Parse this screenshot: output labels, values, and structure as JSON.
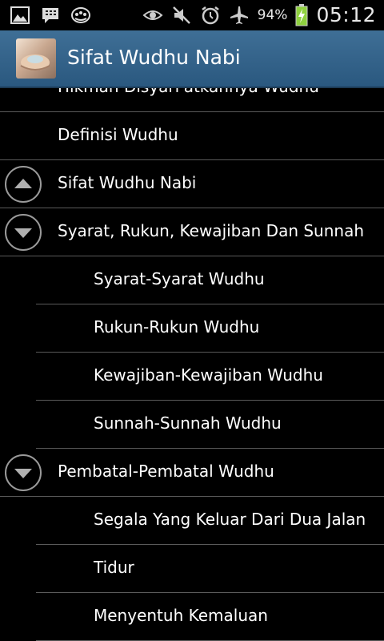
{
  "status_bar": {
    "left_icons": [
      "gallery-icon",
      "bbm-icon",
      "app-update-icon"
    ],
    "right_icons": [
      "eye-icon",
      "mute-icon",
      "alarm-icon",
      "airplane-icon",
      "battery-charging-icon"
    ],
    "battery": "94%",
    "time": "05:12"
  },
  "action_bar": {
    "title": "Sifat Wudhu Nabi",
    "bg_color": "#33658c"
  },
  "list": {
    "partial_top": "Hikmah Disyari'atkannya Wudhu",
    "rows": [
      {
        "type": "group",
        "label": "Definisi Wudhu",
        "indicator": null
      },
      {
        "type": "group",
        "label": "Sifat Wudhu Nabi",
        "indicator": "collapsed"
      },
      {
        "type": "group",
        "label": "Syarat, Rukun, Kewajiban Dan Sunnah",
        "indicator": "expanded"
      },
      {
        "type": "child",
        "label": "Syarat-Syarat Wudhu"
      },
      {
        "type": "child",
        "label": "Rukun-Rukun Wudhu"
      },
      {
        "type": "child",
        "label": "Kewajiban-Kewajiban Wudhu"
      },
      {
        "type": "child",
        "label": "Sunnah-Sunnah Wudhu"
      },
      {
        "type": "group",
        "label": "Pembatal-Pembatal Wudhu",
        "indicator": "expanded"
      },
      {
        "type": "child",
        "label": "Segala Yang Keluar Dari Dua Jalan"
      },
      {
        "type": "child",
        "label": "Tidur"
      },
      {
        "type": "child",
        "label": "Menyentuh Kemaluan"
      }
    ]
  }
}
